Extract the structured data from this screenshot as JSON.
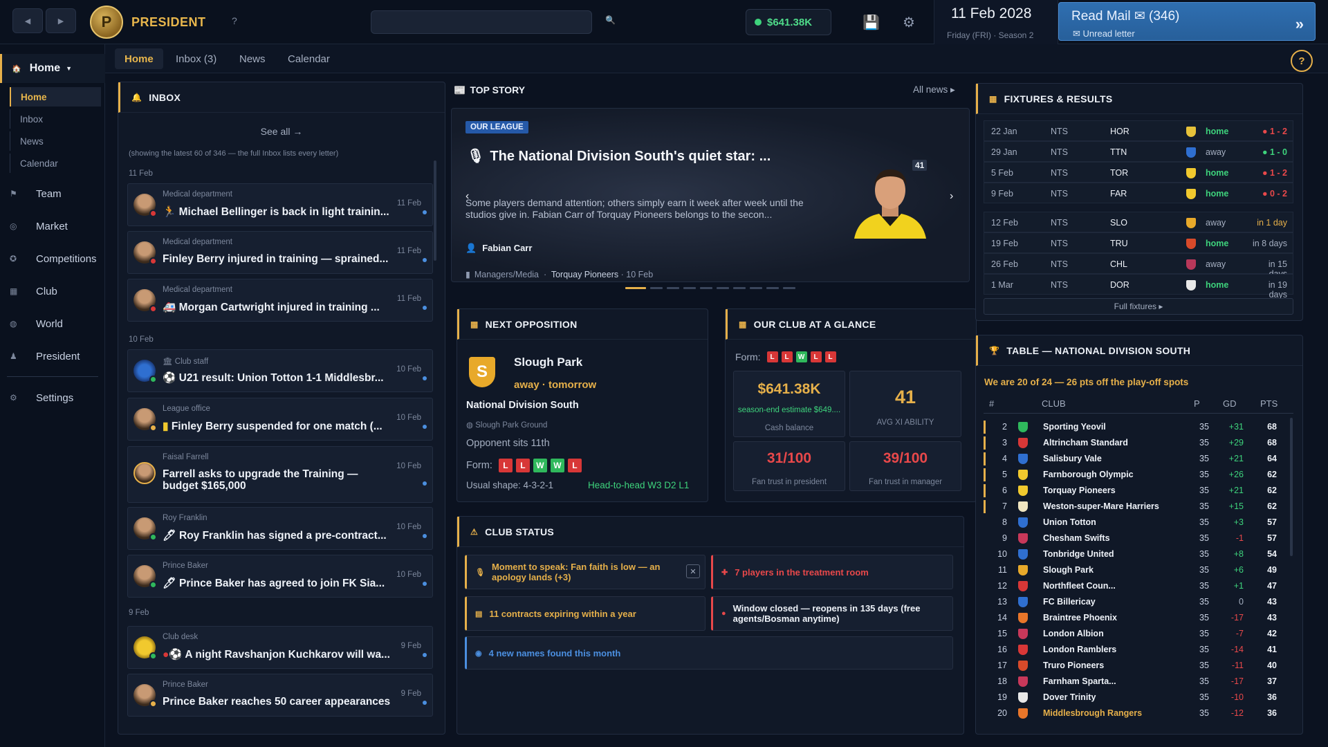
{
  "topbar": {
    "back_icon": "left-arrow-icon",
    "forward_icon": "right-arrow-icon",
    "brand": "PRESIDENT",
    "help": "?",
    "search_placeholder": "",
    "money": "$641.38K",
    "date": "11 Feb 2028",
    "date_sub": "Friday (FRI) · Season 2",
    "mail_title": "Read Mail ✉ (346)",
    "mail_sub": "Unread letter",
    "mail_chevron": "»"
  },
  "sidebar": {
    "home": "Home",
    "sub": [
      "Home",
      "Inbox",
      "News",
      "Calendar"
    ],
    "items": [
      "Team",
      "Market",
      "Competitions",
      "Club",
      "World",
      "President",
      "Settings"
    ]
  },
  "tabs": [
    "Home",
    "Inbox (3)",
    "News",
    "Calendar"
  ],
  "inbox": {
    "title": "INBOX",
    "see_all": "See all →",
    "note": "(showing the latest 60 of 346 — the full Inbox lists every letter)",
    "days": [
      "11 Feb",
      "10 Feb",
      "9 Feb"
    ],
    "mails": [
      {
        "dept": "Medical department",
        "subject": "Michael Bellinger is back in light trainin...",
        "date": "11 Feb",
        "icon": "🏃"
      },
      {
        "dept": "Medical department",
        "subject": "Finley Berry injured in training — sprained...",
        "date": "11 Feb",
        "icon": ""
      },
      {
        "dept": "Medical department",
        "subject": "Morgan Cartwright injured in training ...",
        "date": "11 Feb",
        "icon": "🚑"
      },
      {
        "dept": "Club staff",
        "subject": "U21 result: Union Totton 1-1 Middlesbr...",
        "date": "10 Feb",
        "icon": "⚽"
      },
      {
        "dept": "League office",
        "subject": "Finley Berry suspended for one match (...",
        "date": "10 Feb",
        "icon": "▮"
      },
      {
        "dept": "Faisal Farrell",
        "subject": "Farrell asks to upgrade the Training — budget $165,000",
        "date": "10 Feb",
        "icon": ""
      },
      {
        "dept": "Roy Franklin",
        "subject": "Roy Franklin has signed a pre-contract...",
        "date": "10 Feb",
        "icon": "🖊"
      },
      {
        "dept": "Prince Baker",
        "subject": "Prince Baker has agreed to join FK Sia...",
        "date": "10 Feb",
        "icon": "🖊"
      },
      {
        "dept": "Club desk",
        "subject": "A night Ravshanjon Kuchkarov will wa...",
        "date": "9 Feb",
        "icon": "⚽"
      },
      {
        "dept": "Prince Baker",
        "subject": "Prince Baker reaches 50 career appearances",
        "date": "9 Feb",
        "icon": ""
      }
    ]
  },
  "top_story": {
    "heading": "TOP STORY",
    "all_news": "All news ▸",
    "tag": "OUR LEAGUE",
    "title": "The National Division South's quiet star: ...",
    "body": "Some players demand attention; others simply earn it week after week until the studios give in. Fabian Carr of Torquay Pioneers belongs to the secon...",
    "player": "Fabian Carr",
    "age": "41",
    "meta_source": "Managers/Media",
    "meta_club": "Torquay Pioneers",
    "meta_date": "· 10 Feb"
  },
  "next_opposition": {
    "title": "NEXT OPPOSITION",
    "badge": "S",
    "team": "Slough Park",
    "when": "away · tomorrow",
    "league": "National Division South",
    "ground": "Slough Park Ground",
    "position": "Opponent sits 11th",
    "form_label": "Form:",
    "form": [
      "L",
      "L",
      "W",
      "W",
      "L"
    ],
    "shape": "Usual shape: 4-3-2-1",
    "h2h": "Head-to-head W3 D2 L1"
  },
  "glance": {
    "title": "OUR CLUB AT A GLANCE",
    "form_label": "Form:",
    "form": [
      "L",
      "L",
      "W",
      "L",
      "L"
    ],
    "cash": "$641.38K",
    "cash_sub": "season-end estimate $649....",
    "cash_label": "Cash balance",
    "ability": "41",
    "ability_label": "AVG XI ABILITY",
    "trust_president": "31/100",
    "trust_president_label": "Fan trust in president",
    "trust_manager": "39/100",
    "trust_manager_label": "Fan trust in manager"
  },
  "club_status": {
    "title": "CLUB STATUS",
    "items": [
      "Moment to speak: Fan faith is low — an apology lands (+3)",
      "7 players in the treatment room",
      "11 contracts expiring within a year",
      "Window closed — reopens in 135 days (free agents/Bosman anytime)",
      "4 new names found this month"
    ],
    "dismiss": "✕"
  },
  "fixtures": {
    "title": "FIXTURES & RESULTS",
    "rows": [
      {
        "date": "22 Jan",
        "comp": "NTS",
        "opp": "HOR",
        "venue": "home",
        "res": "1 - 2",
        "status": "loss",
        "crest": "#e6c23a"
      },
      {
        "date": "29 Jan",
        "comp": "NTS",
        "opp": "TTN",
        "venue": "away",
        "res": "1 - 0",
        "status": "win",
        "crest": "#2f6fd0"
      },
      {
        "date": "5 Feb",
        "comp": "NTS",
        "opp": "TOR",
        "venue": "home",
        "res": "1 - 2",
        "status": "loss",
        "crest": "#f1c92e"
      },
      {
        "date": "9 Feb",
        "comp": "NTS",
        "opp": "FAR",
        "venue": "home",
        "res": "0 - 2",
        "status": "loss",
        "crest": "#f1c92e"
      },
      {
        "date": "12 Feb",
        "comp": "NTS",
        "opp": "SLO",
        "venue": "away",
        "res": "in 1 day",
        "status": "next",
        "crest": "#e8a92a"
      },
      {
        "date": "19 Feb",
        "comp": "NTS",
        "opp": "TRU",
        "venue": "home",
        "res": "in 8 days",
        "status": "future",
        "crest": "#d84a2a"
      },
      {
        "date": "26 Feb",
        "comp": "NTS",
        "opp": "CHL",
        "venue": "away",
        "res": "in 15 days",
        "status": "future",
        "crest": "#b8385a"
      },
      {
        "date": "1 Mar",
        "comp": "NTS",
        "opp": "DOR",
        "venue": "home",
        "res": "in 19 days",
        "status": "future",
        "crest": "#e8e8e8"
      }
    ],
    "full": "Full fixtures ▸"
  },
  "table": {
    "title": "TABLE — NATIONAL DIVISION SOUTH",
    "subtitle": "We are 20 of 24 — 26 pts off the play-off spots",
    "headers": [
      "#",
      "CLUB",
      "P",
      "GD",
      "PTS"
    ],
    "rows": [
      {
        "pos": "2",
        "club": "Sporting Yeovil",
        "p": "35",
        "gd": "+31",
        "pts": "68",
        "crest": "#2fb85c",
        "hl": true
      },
      {
        "pos": "3",
        "club": "Altrincham Standard",
        "p": "35",
        "gd": "+29",
        "pts": "68",
        "crest": "#d83737",
        "hl": true
      },
      {
        "pos": "4",
        "club": "Salisbury Vale",
        "p": "35",
        "gd": "+21",
        "pts": "64",
        "crest": "#2f6fd0",
        "hl": true
      },
      {
        "pos": "5",
        "club": "Farnborough Olympic",
        "p": "35",
        "gd": "+26",
        "pts": "62",
        "crest": "#f1c92e",
        "hl": true
      },
      {
        "pos": "6",
        "club": "Torquay Pioneers",
        "p": "35",
        "gd": "+21",
        "pts": "62",
        "crest": "#f1c92e",
        "hl": true
      },
      {
        "pos": "7",
        "club": "Weston-super-Mare Harriers",
        "p": "35",
        "gd": "+15",
        "pts": "62",
        "crest": "#efe5c0",
        "hl": true
      },
      {
        "pos": "8",
        "club": "Union Totton",
        "p": "35",
        "gd": "+3",
        "pts": "57",
        "crest": "#2f6fd0",
        "hl": false
      },
      {
        "pos": "9",
        "club": "Chesham Swifts",
        "p": "35",
        "gd": "-1",
        "pts": "57",
        "crest": "#c8385a",
        "hl": false
      },
      {
        "pos": "10",
        "club": "Tonbridge United",
        "p": "35",
        "gd": "+8",
        "pts": "54",
        "crest": "#2f6fd0",
        "hl": false
      },
      {
        "pos": "11",
        "club": "Slough Park",
        "p": "35",
        "gd": "+6",
        "pts": "49",
        "crest": "#e8a92a",
        "hl": false
      },
      {
        "pos": "12",
        "club": "Northfleet Coun...",
        "p": "35",
        "gd": "+1",
        "pts": "47",
        "crest": "#d83737",
        "hl": false
      },
      {
        "pos": "13",
        "club": "FC Billericay",
        "p": "35",
        "gd": "0",
        "pts": "43",
        "crest": "#2f6fd0",
        "hl": false
      },
      {
        "pos": "14",
        "club": "Braintree Phoenix",
        "p": "35",
        "gd": "-17",
        "pts": "43",
        "crest": "#e8762a",
        "hl": false
      },
      {
        "pos": "15",
        "club": "London Albion",
        "p": "35",
        "gd": "-7",
        "pts": "42",
        "crest": "#c8385a",
        "hl": false
      },
      {
        "pos": "16",
        "club": "London Ramblers",
        "p": "35",
        "gd": "-14",
        "pts": "41",
        "crest": "#d83737",
        "hl": false
      },
      {
        "pos": "17",
        "club": "Truro Pioneers",
        "p": "35",
        "gd": "-11",
        "pts": "40",
        "crest": "#d84a2a",
        "hl": false
      },
      {
        "pos": "18",
        "club": "Farnham Sparta...",
        "p": "35",
        "gd": "-17",
        "pts": "37",
        "crest": "#c8385a",
        "hl": false
      },
      {
        "pos": "19",
        "club": "Dover Trinity",
        "p": "35",
        "gd": "-10",
        "pts": "36",
        "crest": "#e8e8e8",
        "hl": false
      },
      {
        "pos": "20",
        "club": "Middlesbrough Rangers",
        "p": "35",
        "gd": "-12",
        "pts": "36",
        "crest": "#e8762a",
        "hl": false,
        "ours": true
      }
    ]
  },
  "colors": {
    "accent": "#e6b04a",
    "positive": "#3ed37c",
    "negative": "#e8484a",
    "link": "#4b8fe0"
  }
}
